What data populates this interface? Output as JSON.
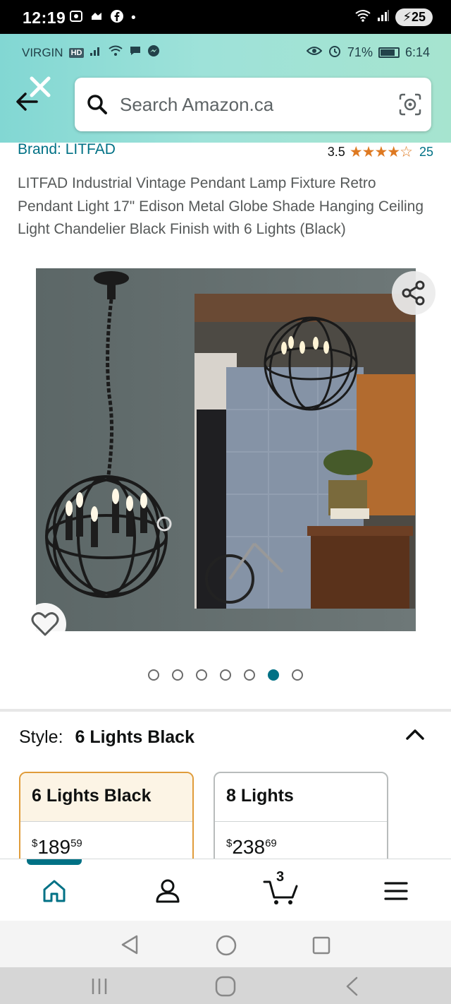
{
  "outer_status": {
    "time": "12:19",
    "battery": "25"
  },
  "inner_status": {
    "carrier": "VIRGIN",
    "hd": "HD",
    "battery_pct": "71%",
    "time": "6:14"
  },
  "search": {
    "placeholder": "Search Amazon.ca"
  },
  "product": {
    "brand": "Brand: LITFAD",
    "rating": "3.5",
    "stars": "★★★★☆",
    "stars_value": 3.5,
    "review_count": "25",
    "title": "LITFAD Industrial Vintage Pendant Lamp Fixture Retro Pendant Light 17\" Edison Metal Globe Shade Hanging Ceiling Light Chandelier Black Finish with 6 Lights (Black)"
  },
  "carousel": {
    "total_images": 7,
    "active_index": 5
  },
  "style": {
    "label": "Style:",
    "selected": "6 Lights Black",
    "options": [
      {
        "name": "6 Lights Black",
        "currency": "$",
        "price_whole": "189",
        "price_cents": "59",
        "selected": true
      },
      {
        "name": "8 Lights",
        "currency": "$",
        "price_whole": "238",
        "price_cents": "69",
        "selected": false
      }
    ]
  },
  "nav": {
    "cart_count": "3",
    "items": [
      "home-icon",
      "account-icon",
      "cart-icon",
      "menu-icon"
    ]
  },
  "colors": {
    "accent": "#007185",
    "star": "#de7921",
    "header_start": "#82d7d3",
    "header_end": "#a6e4cf",
    "selected_border": "#e09c3a"
  }
}
